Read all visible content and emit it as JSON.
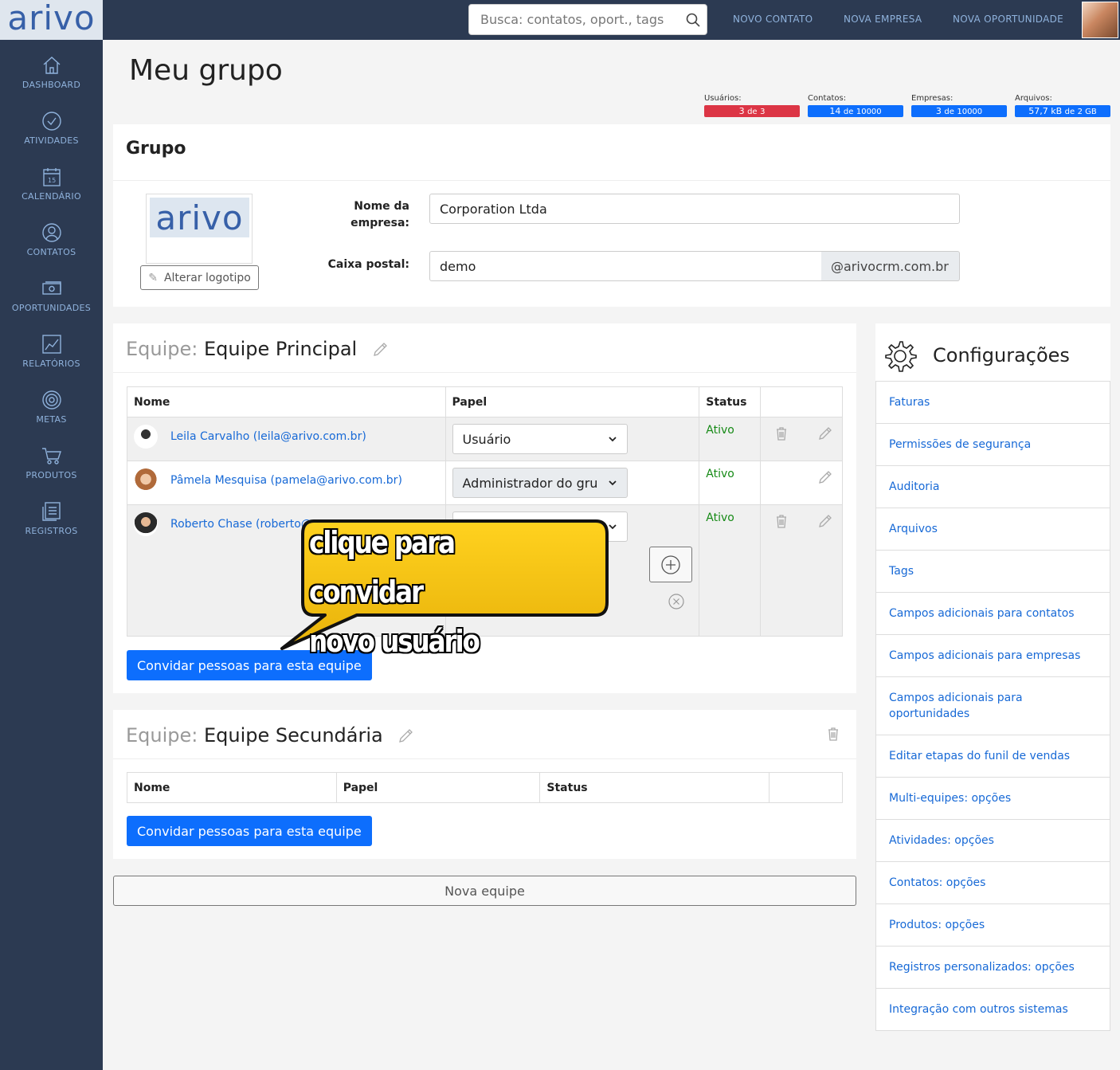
{
  "app": {
    "logo": "arivo"
  },
  "sidebar": {
    "items": [
      {
        "label": "DASHBOARD",
        "icon": "house-icon"
      },
      {
        "label": "ATIVIDADES",
        "icon": "check-circle-icon"
      },
      {
        "label": "CALENDÁRIO",
        "icon": "calendar-icon",
        "day": "15"
      },
      {
        "label": "CONTATOS",
        "icon": "person-icon"
      },
      {
        "label": "OPORTUNIDADES",
        "icon": "money-icon"
      },
      {
        "label": "RELATÓRIOS",
        "icon": "chart-icon"
      },
      {
        "label": "METAS",
        "icon": "target-icon"
      },
      {
        "label": "PRODUTOS",
        "icon": "cart-icon"
      },
      {
        "label": "REGISTROS",
        "icon": "records-icon"
      }
    ]
  },
  "topbar": {
    "search_placeholder": "Busca: contatos, oport., tags",
    "links": [
      "NOVO CONTATO",
      "NOVA EMPRESA",
      "NOVA OPORTUNIDADE"
    ]
  },
  "page": {
    "title": "Meu grupo"
  },
  "quotas": [
    {
      "label": "Usuários:",
      "value": "3",
      "sep": "de",
      "total": "3",
      "color": "#dc3545",
      "fraction": 1.0
    },
    {
      "label": "Contatos:",
      "value": "14",
      "sep": "de",
      "total": "10000",
      "color": "#0d6efd",
      "fraction": 0.0014
    },
    {
      "label": "Empresas:",
      "value": "3",
      "sep": "de",
      "total": "10000",
      "color": "#0d6efd",
      "fraction": 0.0003
    },
    {
      "label": "Arquivos:",
      "value": "57,7 kB",
      "sep": "de",
      "total": "2 GB",
      "color": "#0d6efd",
      "fraction": 3e-05
    }
  ],
  "grupo": {
    "title": "Grupo",
    "change_logo": "Alterar logotipo",
    "company_label": "Nome da empresa:",
    "company_value": "Corporation Ltda",
    "mailbox_label": "Caixa postal:",
    "mailbox_value": "demo",
    "mailbox_domain": "@arivocrm.com.br"
  },
  "team_main": {
    "prefix": "Equipe:",
    "name": "Equipe Principal",
    "columns": [
      "Nome",
      "Papel",
      "Status"
    ],
    "members": [
      {
        "name": "Leila Carvalho (leila@arivo.com.br)",
        "role": "Usuário",
        "status": "Ativo"
      },
      {
        "name": "Pâmela Mesquisa (pamela@arivo.com.br)",
        "role": "Administrador do gru",
        "status": "Ativo"
      },
      {
        "name": "Roberto Chase (roberto@",
        "role": "",
        "status": "Ativo"
      }
    ],
    "invite": "Convidar pessoas para esta equipe"
  },
  "team_secondary": {
    "prefix": "Equipe:",
    "name": "Equipe Secundária",
    "columns": [
      "Nome",
      "Papel",
      "Status"
    ],
    "invite": "Convidar pessoas para esta equipe"
  },
  "new_team": "Nova equipe",
  "callout": {
    "line1": "clique para convidar",
    "line2": "novo usuário"
  },
  "settings": {
    "title": "Configurações",
    "items": [
      "Faturas",
      "Permissões de segurança",
      "Auditoria",
      "Arquivos",
      "Tags",
      "Campos adicionais para contatos",
      "Campos adicionais para empresas",
      "Campos adicionais para oportunidades",
      "Editar etapas do funil de vendas",
      "Multi-equipes: opções",
      "Atividades: opções",
      "Contatos: opções",
      "Produtos: opções",
      "Registros personalizados: opções",
      "Integração com outros sistemas"
    ]
  }
}
